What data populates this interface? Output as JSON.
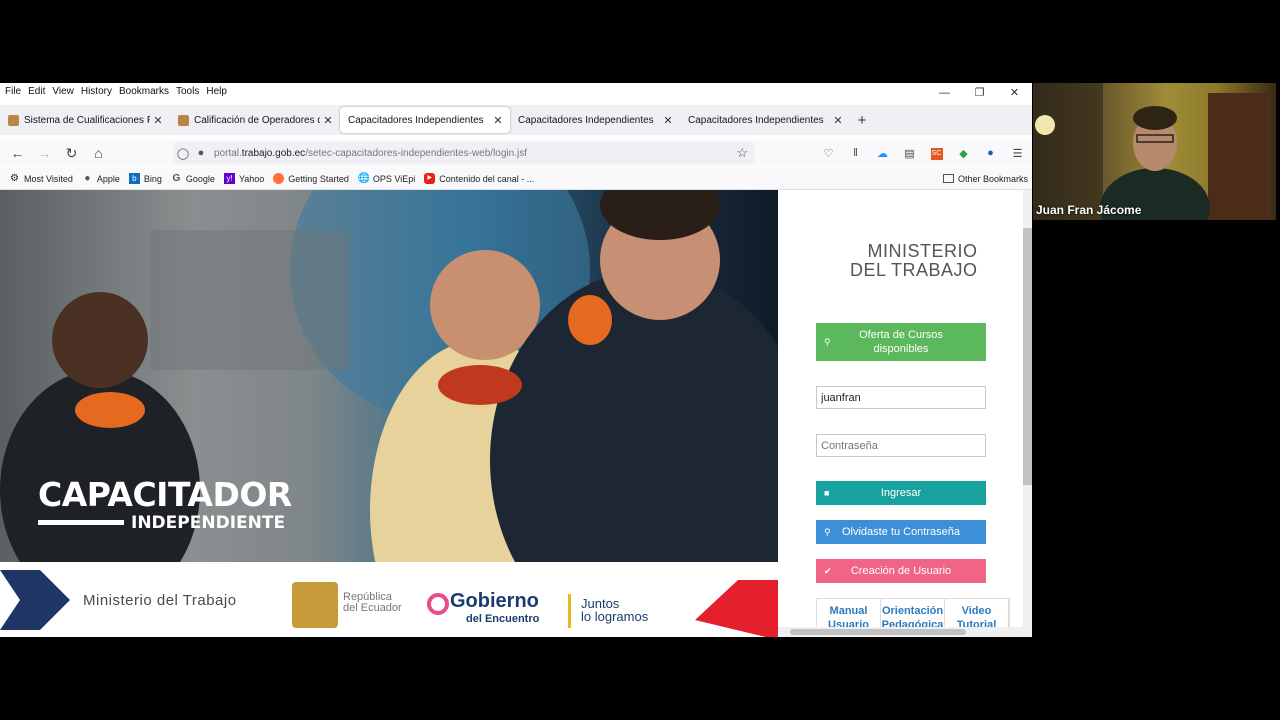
{
  "menubar": {
    "items": [
      "File",
      "Edit",
      "View",
      "History",
      "Bookmarks",
      "Tools",
      "Help"
    ]
  },
  "tabs": [
    {
      "title": "Sistema de Cualificaciones Prof",
      "active": false
    },
    {
      "title": "Calificación de Operadores de C",
      "active": false
    },
    {
      "title": "Capacitadores Independientes",
      "active": true
    },
    {
      "title": "Capacitadores Independientes",
      "active": false
    },
    {
      "title": "Capacitadores Independientes",
      "active": false
    }
  ],
  "address": {
    "prefix": "portal.",
    "domain": "trabajo.gob.ec",
    "path": "/setec-capacitadores-independientes-web/login.jsf"
  },
  "bookmarks": [
    "Most Visited",
    "Apple",
    "Bing",
    "Google",
    "Yahoo",
    "Getting Started",
    "OPS ViEpi",
    "Contenido del canal - ..."
  ],
  "other_bookmarks": "Other Bookmarks",
  "hero": {
    "title": "CAPACITADOR",
    "subtitle": "INDEPENDIENTE"
  },
  "footer": {
    "ministerio": "Ministerio del Trabajo",
    "republica": [
      "República",
      "del Ecuador"
    ],
    "gobierno": "Gobierno",
    "encuentro": "del Encuentro",
    "juntos": [
      "Juntos",
      "lo logramos"
    ]
  },
  "sidebar": {
    "logo": [
      "MINISTERIO",
      "DEL TRABAJO"
    ],
    "oferta_label": "Oferta de Cursos disponibles",
    "username_value": "juanfran",
    "password_placeholder": "Contraseña",
    "ingresar_label": "Ingresar",
    "olvidaste_label": "Olvidaste tu Contraseña",
    "creacion_label": "Creación de Usuario",
    "bottom_tabs": [
      "Manual Usuario",
      "Orientación Pedagógica",
      "Video Tutorial"
    ]
  },
  "webcam": {
    "name": "Juan Fran Jácome"
  },
  "colors": {
    "green": "#5cb85c",
    "teal": "#17a2a0",
    "blue": "#3d8fd8",
    "pink": "#f06486"
  }
}
